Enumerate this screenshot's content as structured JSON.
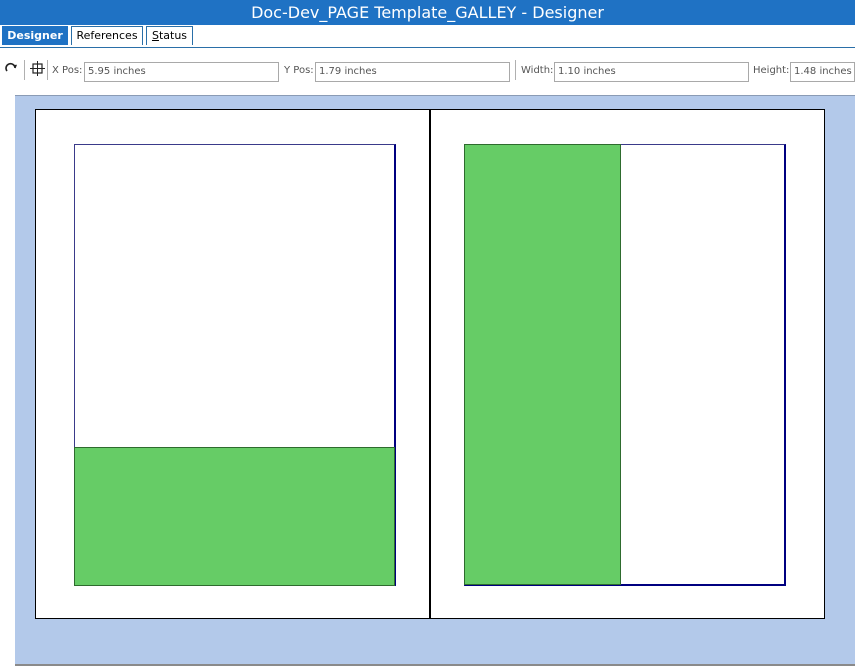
{
  "window": {
    "title": "Doc-Dev_PAGE Template_GALLEY - Designer"
  },
  "tabs": [
    {
      "label": "Designer",
      "active": true
    },
    {
      "label": "References",
      "active": false
    },
    {
      "label_prefix": "",
      "label_underline": "S",
      "label_rest": "tatus",
      "active": false
    }
  ],
  "toolbar": {
    "x_pos": {
      "label": "X Pos:",
      "value": "5.95 inches"
    },
    "y_pos": {
      "label": "Y Pos:",
      "value": "1.79 inches"
    },
    "width": {
      "label": "Width:",
      "value": "1.10 inches"
    },
    "height": {
      "label": "Height:",
      "value": "1.48 inches"
    }
  },
  "icons": {
    "rotate": "redo-arrow-icon",
    "frame": "frame-select-icon"
  },
  "colors": {
    "title_bar": "#1f72c4",
    "canvas_background": "#b3c9ea",
    "content_block": "#66cc66",
    "page_border": "#000080"
  }
}
